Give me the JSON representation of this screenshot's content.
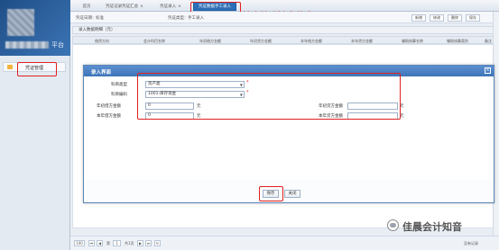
{
  "sidebar": {
    "platform_text": "平台",
    "menu_item_label": "凭证管理"
  },
  "tabs": [
    {
      "label": "首页"
    },
    {
      "label": "凭证记录凭证汇总"
    },
    {
      "label": "凭证录入"
    },
    {
      "label": "凭证数据手工录入"
    }
  ],
  "watermark_title": "禁止处理涉密信息",
  "toolbar": {
    "period_label": "凭证日期：",
    "period_value": "标准",
    "type_label": "凭证类型：",
    "type_value": "手工录入",
    "buttons": [
      "新增",
      "修改",
      "删除",
      "保存"
    ]
  },
  "grid": {
    "title": "录入数据明细（元）",
    "headers": [
      "借贷方向",
      "会计科目名称",
      "年初借方金额",
      "年初贷方金额",
      "本年借方金额",
      "本年贷方金额",
      "辅助核算名称",
      "辅助核算类别",
      "备注"
    ]
  },
  "modal": {
    "title": "录入界面",
    "close": "×",
    "fields": {
      "subject_type_label": "科目类型",
      "subject_type_value": "资产类",
      "subject_code_label": "科目编码",
      "subject_code_value": "1001-库存现金",
      "opening_debit_label": "年初借方金额",
      "opening_debit_value": "0",
      "opening_credit_label": "年初贷方金额",
      "current_debit_label": "本年借方金额",
      "current_debit_value": "0",
      "current_credit_label": "本年贷方金额",
      "unit": "元"
    },
    "save_label": "保存",
    "close_label": "关闭"
  },
  "footer": {
    "page_size": "100",
    "page_label": "第",
    "page_number": "1",
    "page_of": "共1页",
    "record_text": "没有记录"
  },
  "brand_watermark": "佳晨会计知音",
  "colors": {
    "accent": "#2d6fb6",
    "modal_header": "#4a80c2",
    "highlight": "#e02020"
  }
}
